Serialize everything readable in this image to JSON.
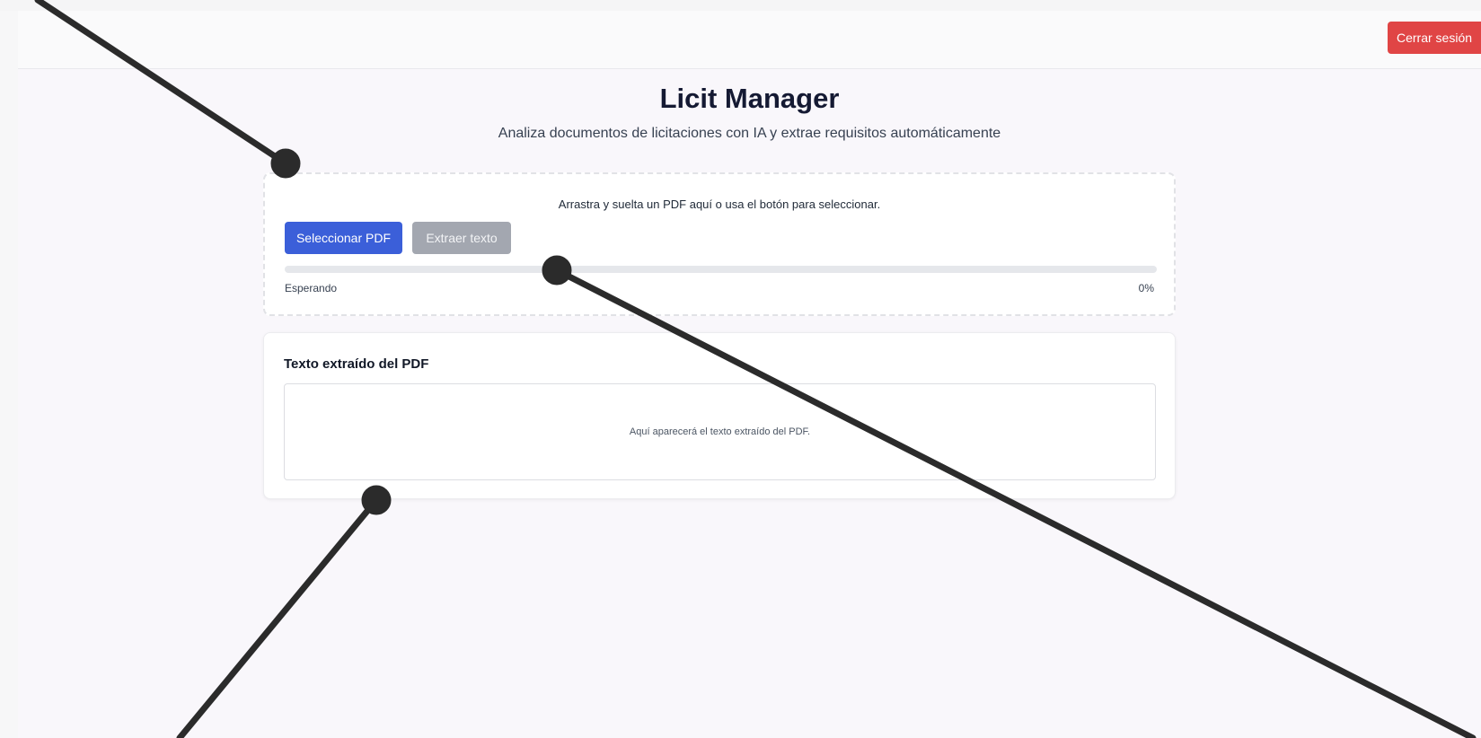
{
  "header": {
    "logout_label": "Cerrar sesión"
  },
  "hero": {
    "title": "Licit Manager",
    "subtitle": "Analiza documentos de licitaciones con IA y extrae requisitos automáticamente"
  },
  "upload": {
    "hint": "Arrastra y suelta un PDF aquí o usa el botón para seleccionar.",
    "select_label": "Seleccionar PDF",
    "extract_label": "Extraer texto",
    "extract_enabled": false,
    "progress_value": 0,
    "status_text": "Esperando",
    "percent_text": "0%"
  },
  "extracted": {
    "title": "Texto extraído del PDF",
    "placeholder": "Aquí aparecerá el texto extraído del PDF."
  },
  "colors": {
    "primary": "#3b5fd9",
    "danger": "#e04545",
    "disabled": "#a3a7b0",
    "annotation": "#2b2b2b"
  }
}
